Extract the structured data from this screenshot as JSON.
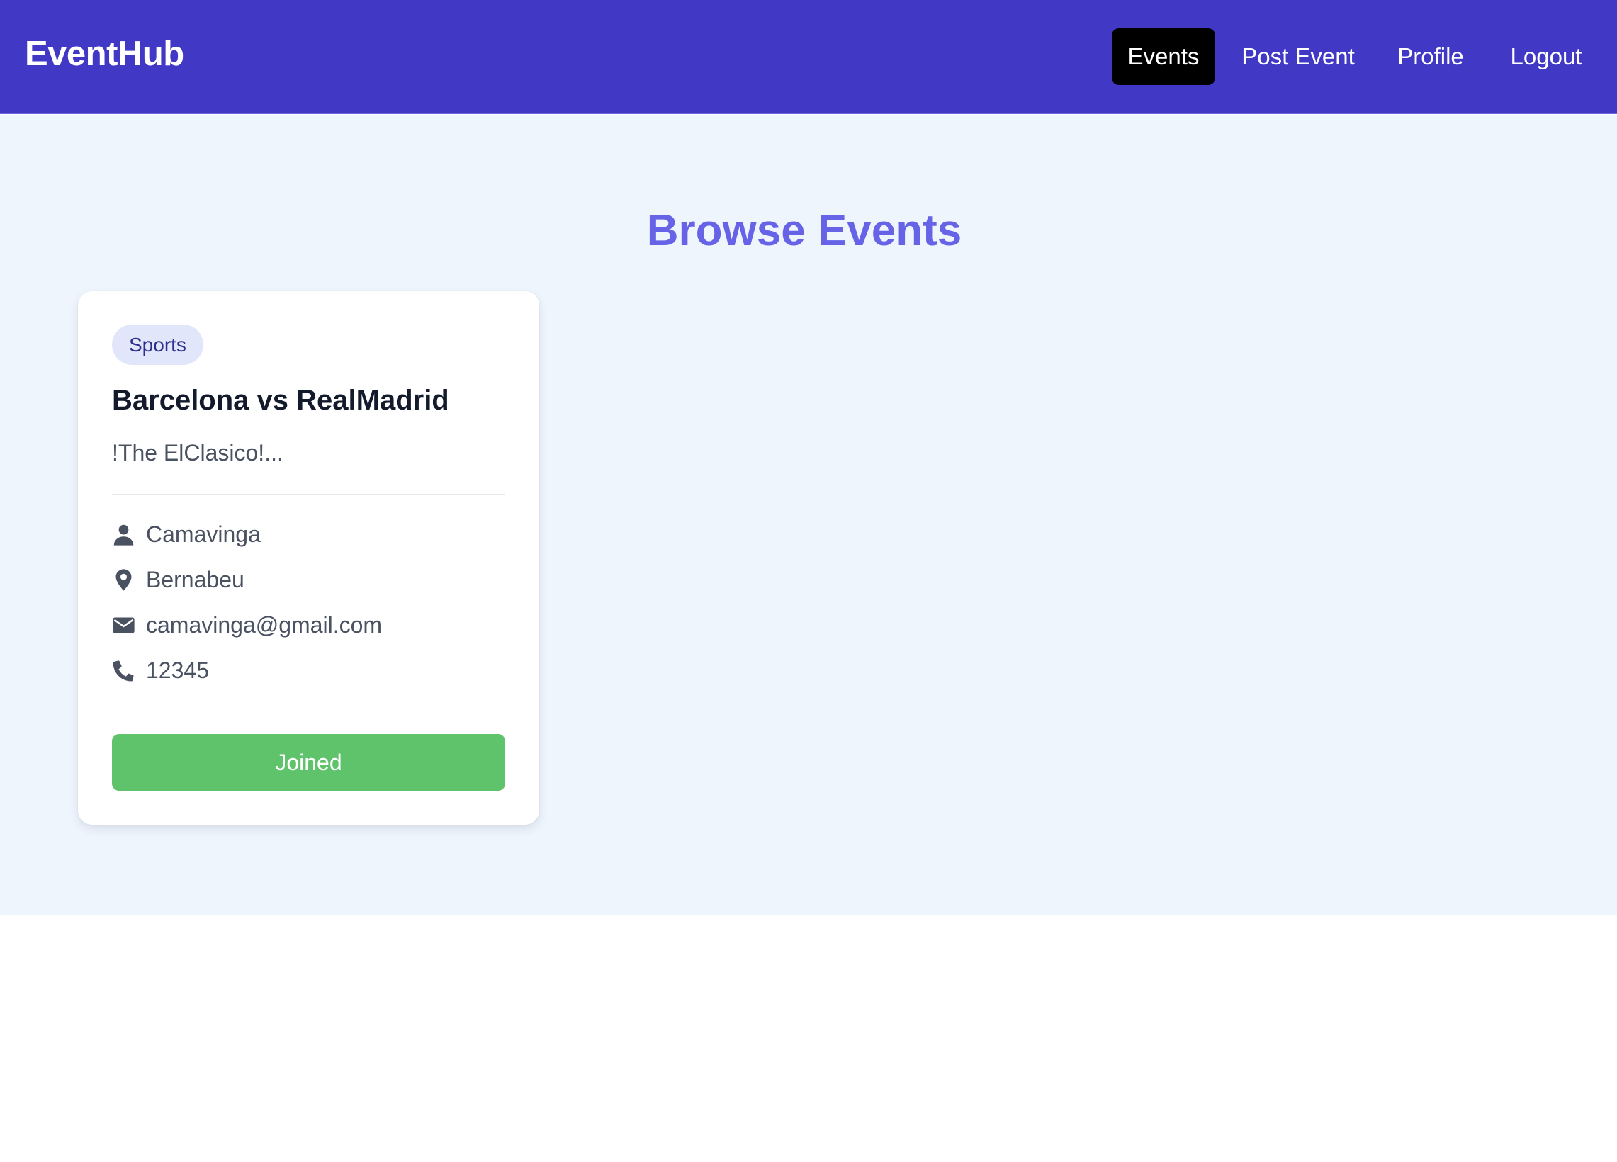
{
  "app": {
    "brand": "EventHub"
  },
  "nav": {
    "items": [
      {
        "label": "Events",
        "active": true
      },
      {
        "label": "Post Event",
        "active": false
      },
      {
        "label": "Profile",
        "active": false
      },
      {
        "label": "Logout",
        "active": false
      }
    ]
  },
  "page": {
    "title": "Browse Events"
  },
  "events": [
    {
      "category": "Sports",
      "title": "Barcelona vs RealMadrid",
      "description": "!The ElClasico!...",
      "organizer": "Camavinga",
      "location": "Bernabeu",
      "email": "camavinga@gmail.com",
      "phone": "12345",
      "button_label": "Joined",
      "icons": {
        "organizer": "user-icon",
        "location": "map-pin-icon",
        "email": "envelope-icon",
        "phone": "phone-icon"
      }
    }
  ],
  "colors": {
    "navbar": "#4139c5",
    "nav_active": "#000000",
    "page_background": "#eff5fd",
    "title": "#6663e7",
    "badge_background": "#e1e6fb",
    "badge_text": "#2d2f8f",
    "button_joined": "#5fc36c",
    "icon": "#4a5161"
  }
}
